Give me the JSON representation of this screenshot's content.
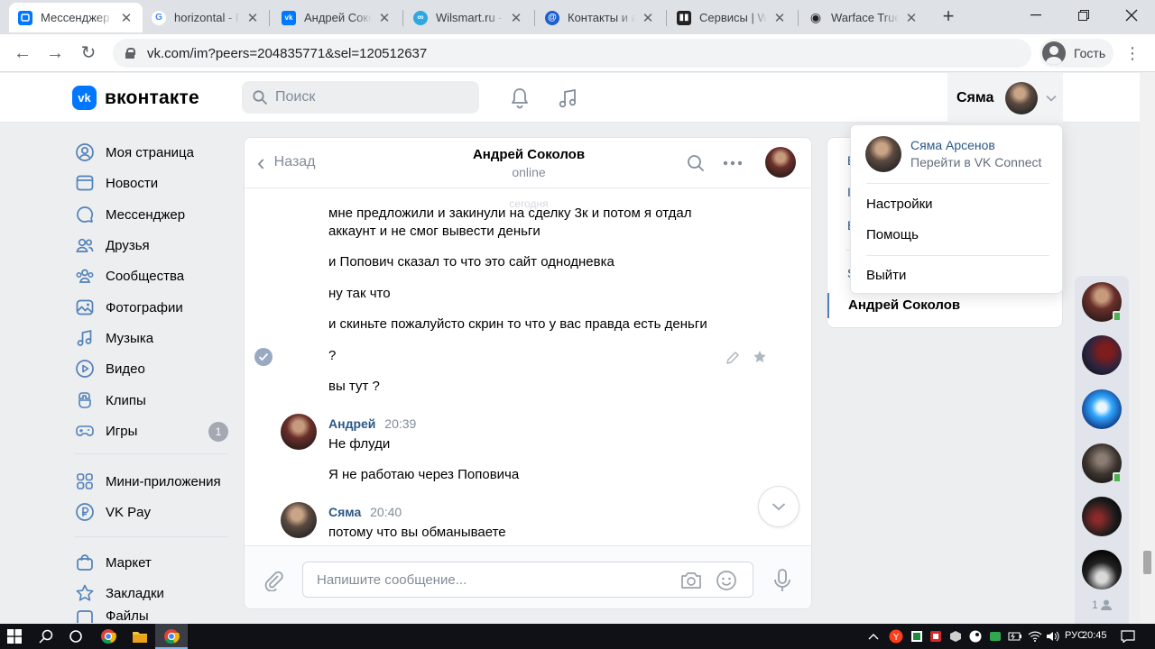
{
  "browser": {
    "tabs": [
      {
        "title": "Мессенджер",
        "color": "#0077ff",
        "glyph": "▢"
      },
      {
        "title": "horizontal - Г",
        "color": "#4285f4",
        "glyph": "G"
      },
      {
        "title": "Андрей Соко",
        "color": "#0077ff",
        "glyph": "vk"
      },
      {
        "title": "Wilsmart.ru -",
        "color": "#2da8e0",
        "glyph": "∞"
      },
      {
        "title": "Контакты и а",
        "color": "#1a5fd0",
        "glyph": "@"
      },
      {
        "title": "Сервисы | W",
        "color": "#222222",
        "glyph": "▮"
      },
      {
        "title": "Warface True",
        "color": "#333333",
        "glyph": "◉"
      }
    ],
    "url": "vk.com/im?peers=204835771&sel=120512637",
    "guest_label": "Гость"
  },
  "header": {
    "logo_text": "вконтакте",
    "search_placeholder": "Поиск",
    "user_name": "Сяма"
  },
  "nav": {
    "items": [
      {
        "label": "Моя страница",
        "icon": "user-circle-icon"
      },
      {
        "label": "Новости",
        "icon": "news-icon"
      },
      {
        "label": "Мессенджер",
        "icon": "message-icon"
      },
      {
        "label": "Друзья",
        "icon": "friends-icon"
      },
      {
        "label": "Сообщества",
        "icon": "groups-icon"
      },
      {
        "label": "Фотографии",
        "icon": "photo-icon"
      },
      {
        "label": "Музыка",
        "icon": "music-icon"
      },
      {
        "label": "Видео",
        "icon": "video-icon"
      },
      {
        "label": "Клипы",
        "icon": "clips-icon"
      },
      {
        "label": "Игры",
        "icon": "gamepad-icon",
        "badge": "1"
      },
      {
        "label": "Мини-приложения",
        "icon": "apps-icon"
      },
      {
        "label": "VK Pay",
        "icon": "vkpay-icon"
      },
      {
        "label": "Маркет",
        "icon": "market-icon"
      },
      {
        "label": "Закладки",
        "icon": "star-icon"
      },
      {
        "label": "Файлы",
        "icon": "files-icon"
      }
    ]
  },
  "chat": {
    "back_label": "Назад",
    "peer_name": "Андрей Соколов",
    "peer_status": "online",
    "ghost_date": "сегодня",
    "messages": [
      {
        "text": "мне предложили и закинули на сделку 3к и потом я отдал аккаунт и не смог вывести деньги"
      },
      {
        "text": "и Попович сказал то что это сайт однодневка"
      },
      {
        "text": "ну так что"
      },
      {
        "text": "и скиньте пожалуйсто скрин то что у вас правда есть деньги"
      },
      {
        "text": "?"
      },
      {
        "text": "вы тут ?"
      }
    ],
    "group2": {
      "author": "Андрей",
      "time": "20:39",
      "lines": [
        "Не флуди",
        "Я не работаю через Поповича"
      ]
    },
    "group3": {
      "author": "Сяма",
      "time": "20:40",
      "lines": [
        "потому что вы обманываете"
      ]
    },
    "compose_placeholder": "Напишите сообщение..."
  },
  "right": {
    "fragments": [
      "В",
      "I",
      "В",
      "S"
    ],
    "active_dialog": "Андрей Соколов",
    "friends_count": "1"
  },
  "dropdown": {
    "name": "Сяма Арсенов",
    "sub": "Перейти в VK Connect",
    "settings": "Настройки",
    "help": "Помощь",
    "logout": "Выйти"
  },
  "taskbar": {
    "lang": "РУС",
    "time": "20:45"
  }
}
